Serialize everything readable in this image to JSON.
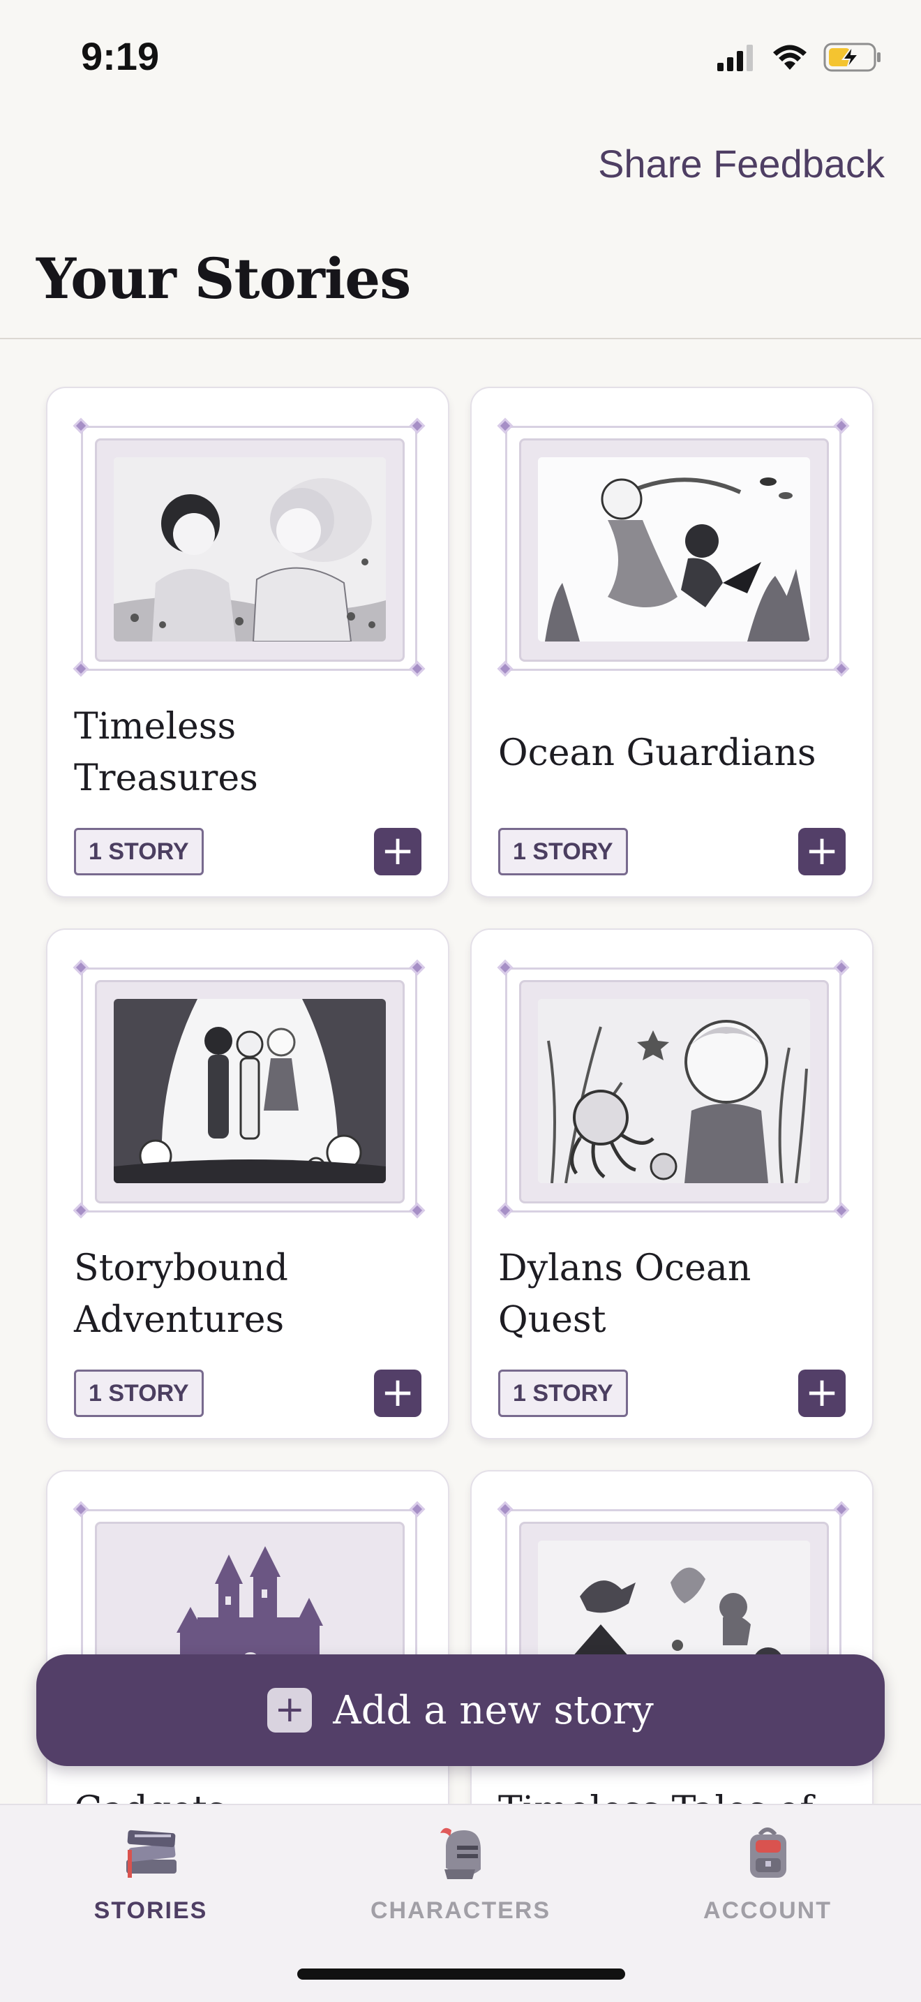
{
  "status_bar": {
    "time": "9:19"
  },
  "header": {
    "feedback_label": "Share Feedback",
    "title": "Your Stories"
  },
  "stories": [
    {
      "title": "Timeless Treasures",
      "badge": "1 STORY",
      "add": "+",
      "illustration": "two-girls-in-meadow"
    },
    {
      "title": "Ocean Guardians",
      "badge": "1 STORY",
      "add": "+",
      "illustration": "mermaid-and-diver"
    },
    {
      "title": "Storybound Adventures",
      "badge": "1 STORY",
      "add": "+",
      "illustration": "children-in-glowing-forest"
    },
    {
      "title": "Dylans Ocean Quest",
      "badge": "1 STORY",
      "add": "+",
      "illustration": "boy-with-octopus-and-coral"
    },
    {
      "title": "Gadgets",
      "badge": "",
      "add": "",
      "illustration": "purple-castle"
    },
    {
      "title": "Timeless Tales of",
      "badge": "",
      "add": "",
      "illustration": "animals-by-pyramid"
    }
  ],
  "add_story": {
    "label": "Add a new story",
    "icon": "plus-icon"
  },
  "bottom_nav": {
    "items": [
      {
        "label": "STORIES",
        "icon": "books-icon",
        "active": true
      },
      {
        "label": "CHARACTERS",
        "icon": "knight-helmet-icon",
        "active": false
      },
      {
        "label": "ACCOUNT",
        "icon": "backpack-icon",
        "active": false
      }
    ]
  },
  "colors": {
    "accent": "#533f68",
    "background": "#f8f7f4",
    "card": "#ffffff",
    "inactive_nav": "#a19fa6"
  }
}
